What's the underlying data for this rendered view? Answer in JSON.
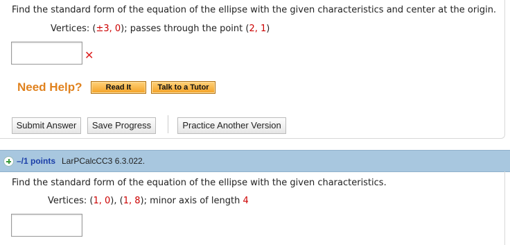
{
  "question1": {
    "prompt": "Find the standard form of the equation of the ellipse with the given characteristics and center at the origin.",
    "given": {
      "vertices_label": "Vertices: (",
      "vertices_value": "±3, 0",
      "sep": "); passes through the point (",
      "point_value": "2, 1",
      "end": ")"
    },
    "answer_value": "",
    "result_mark": "✕"
  },
  "help": {
    "label": "Need Help?",
    "read_it": "Read It",
    "talk_to_tutor": "Talk to a Tutor"
  },
  "actions": {
    "submit": "Submit Answer",
    "save": "Save Progress",
    "practice": "Practice Another Version"
  },
  "question2": {
    "points": "–/1 points",
    "id": "LarPCalcCC3 6.3.022.",
    "prompt": "Find the standard form of the equation of the ellipse with the given characteristics.",
    "given": {
      "vertices_label": "Vertices: (",
      "v1": "1, 0",
      "mid": "), (",
      "v2": "1, 8",
      "minor_label": "); minor axis of length ",
      "minor_value": "4"
    },
    "answer_value": ""
  },
  "colors": {
    "highlight": "#cc0000",
    "help_orange": "#e0821e",
    "header_blue": "#a8c7df",
    "points_blue": "#1a3ea8"
  }
}
